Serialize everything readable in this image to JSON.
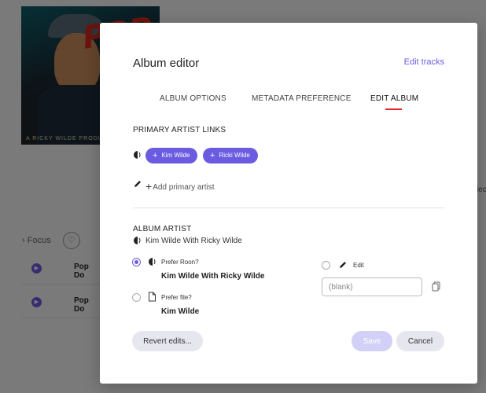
{
  "background": {
    "album_art_text": "POP",
    "album_art_tagline": "A RICKY WILDE PRODUCTION",
    "focus_label": "Focus",
    "track_rows": [
      {
        "title": "Pop Do"
      },
      {
        "title": "Pop Do"
      }
    ],
    "edge_text": "lec"
  },
  "modal": {
    "title": "Album editor",
    "edit_tracks_link": "Edit tracks",
    "tabs": [
      {
        "label": "ALBUM OPTIONS",
        "active": false
      },
      {
        "label": "METADATA PREFERENCE",
        "active": false
      },
      {
        "label": "EDIT ALBUM",
        "active": true
      }
    ],
    "primary_artist_links": {
      "heading": "PRIMARY ARTIST LINKS",
      "chips": [
        {
          "label": "Kim Wilde"
        },
        {
          "label": "Ricki Wilde"
        }
      ],
      "add_label": "Add primary artist"
    },
    "album_artist": {
      "heading": "ALBUM ARTIST",
      "current_value": "Kim Wilde With Ricky Wilde",
      "options": {
        "prefer_roon": {
          "label": "Prefer Roon?",
          "value": "Kim Wilde With Ricky Wilde",
          "selected": true
        },
        "prefer_file": {
          "label": "Prefer file?",
          "value": "Kim Wilde",
          "selected": false
        },
        "edit": {
          "label": "Edit",
          "selected": false,
          "placeholder": "(blank)"
        }
      }
    },
    "buttons": {
      "revert": "Revert edits...",
      "save": "Save",
      "cancel": "Cancel"
    }
  },
  "colors": {
    "accent": "#6a5be0",
    "tab_underline": "#e5262f",
    "save_disabled": "#d3d0f7"
  }
}
